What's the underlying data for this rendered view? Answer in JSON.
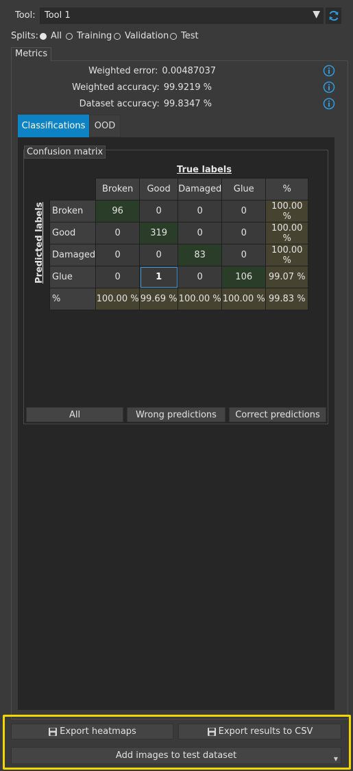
{
  "tool": {
    "label": "Tool:",
    "value": "Tool 1"
  },
  "splits": {
    "label": "Splits:",
    "options": [
      {
        "label": "All",
        "checked": true
      },
      {
        "label": "Training",
        "checked": false
      },
      {
        "label": "Validation",
        "checked": false
      },
      {
        "label": "Test",
        "checked": false
      }
    ]
  },
  "metrics": {
    "title": "Metrics",
    "rows": [
      {
        "label": "Weighted error:",
        "value": "0.00487037"
      },
      {
        "label": "Weighted accuracy:",
        "value": "99.9219 %"
      },
      {
        "label": "Dataset accuracy:",
        "value": "99.8347 %"
      }
    ]
  },
  "tabs": [
    {
      "label": "Classifications",
      "active": true
    },
    {
      "label": "OOD",
      "active": false
    }
  ],
  "confusion_matrix": {
    "title": "Confusion matrix",
    "true_labels": "True labels",
    "predicted_labels": "Predicted labels",
    "columns": [
      "Broken",
      "Good",
      "Damaged",
      "Glue",
      "%"
    ],
    "rows": [
      {
        "label": "Broken",
        "cells": [
          "96",
          "0",
          "0",
          "0",
          "100.00 %"
        ]
      },
      {
        "label": "Good",
        "cells": [
          "0",
          "319",
          "0",
          "0",
          "100.00 %"
        ]
      },
      {
        "label": "Damaged",
        "cells": [
          "0",
          "0",
          "83",
          "0",
          "100.00 %"
        ]
      },
      {
        "label": "Glue",
        "cells": [
          "0",
          "1",
          "0",
          "106",
          "99.07 %"
        ]
      },
      {
        "label": "%",
        "cells": [
          "100.00 %",
          "99.69 %",
          "100.00 %",
          "100.00 %",
          "99.83 %"
        ]
      }
    ],
    "buttons": {
      "all": "All",
      "wrong": "Wrong predictions",
      "correct": "Correct predictions"
    }
  },
  "bottom": {
    "export_heatmaps": "Export heatmaps",
    "export_csv": "Export results to CSV",
    "add_images": "Add images to test dataset"
  },
  "colors": {
    "accent": "#0d82c4",
    "highlight": "#f2d800",
    "diagonal": "#2a3d28",
    "percent_cell": "#474331"
  }
}
